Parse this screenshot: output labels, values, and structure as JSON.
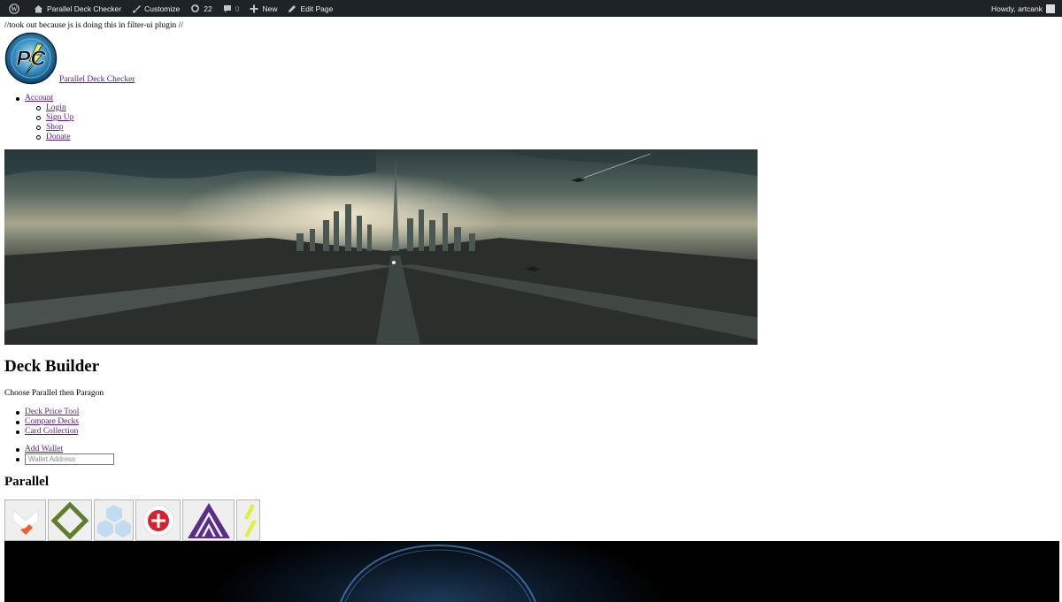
{
  "admin_bar": {
    "site_name": "Parallel Deck Checker",
    "customize": "Customize",
    "updates_count": "22",
    "comments_count": "0",
    "new_label": "New",
    "edit_page": "Edit Page",
    "howdy": "Howdy, artcank"
  },
  "note": "//took out because js is doing this in filter-ui plugin //",
  "site": {
    "title": "Parallel Deck Checker",
    "logo_text": "PC"
  },
  "nav": {
    "account": "Account",
    "items": [
      "Login",
      "Sign Up",
      "Shop",
      "Donate"
    ]
  },
  "page": {
    "title": "Deck Builder",
    "subtitle": "Choose Parallel then Paragon",
    "tools": [
      "Deck Price Tool",
      "Compare Decks",
      "Card Collection"
    ],
    "add_wallet": "Add Wallet",
    "wallet_placeholder": "Wallet Address",
    "section_title": "Parallel"
  },
  "colors": {
    "admin_bar_bg": "#1d2327",
    "link": "#551a8b",
    "faction_orange": "#e8632a",
    "faction_green": "#5f7d2c",
    "faction_blue": "#c2dbf0",
    "faction_red": "#d6222e",
    "faction_purple": "#5b2d8a",
    "faction_yellow": "#e0f03c"
  }
}
